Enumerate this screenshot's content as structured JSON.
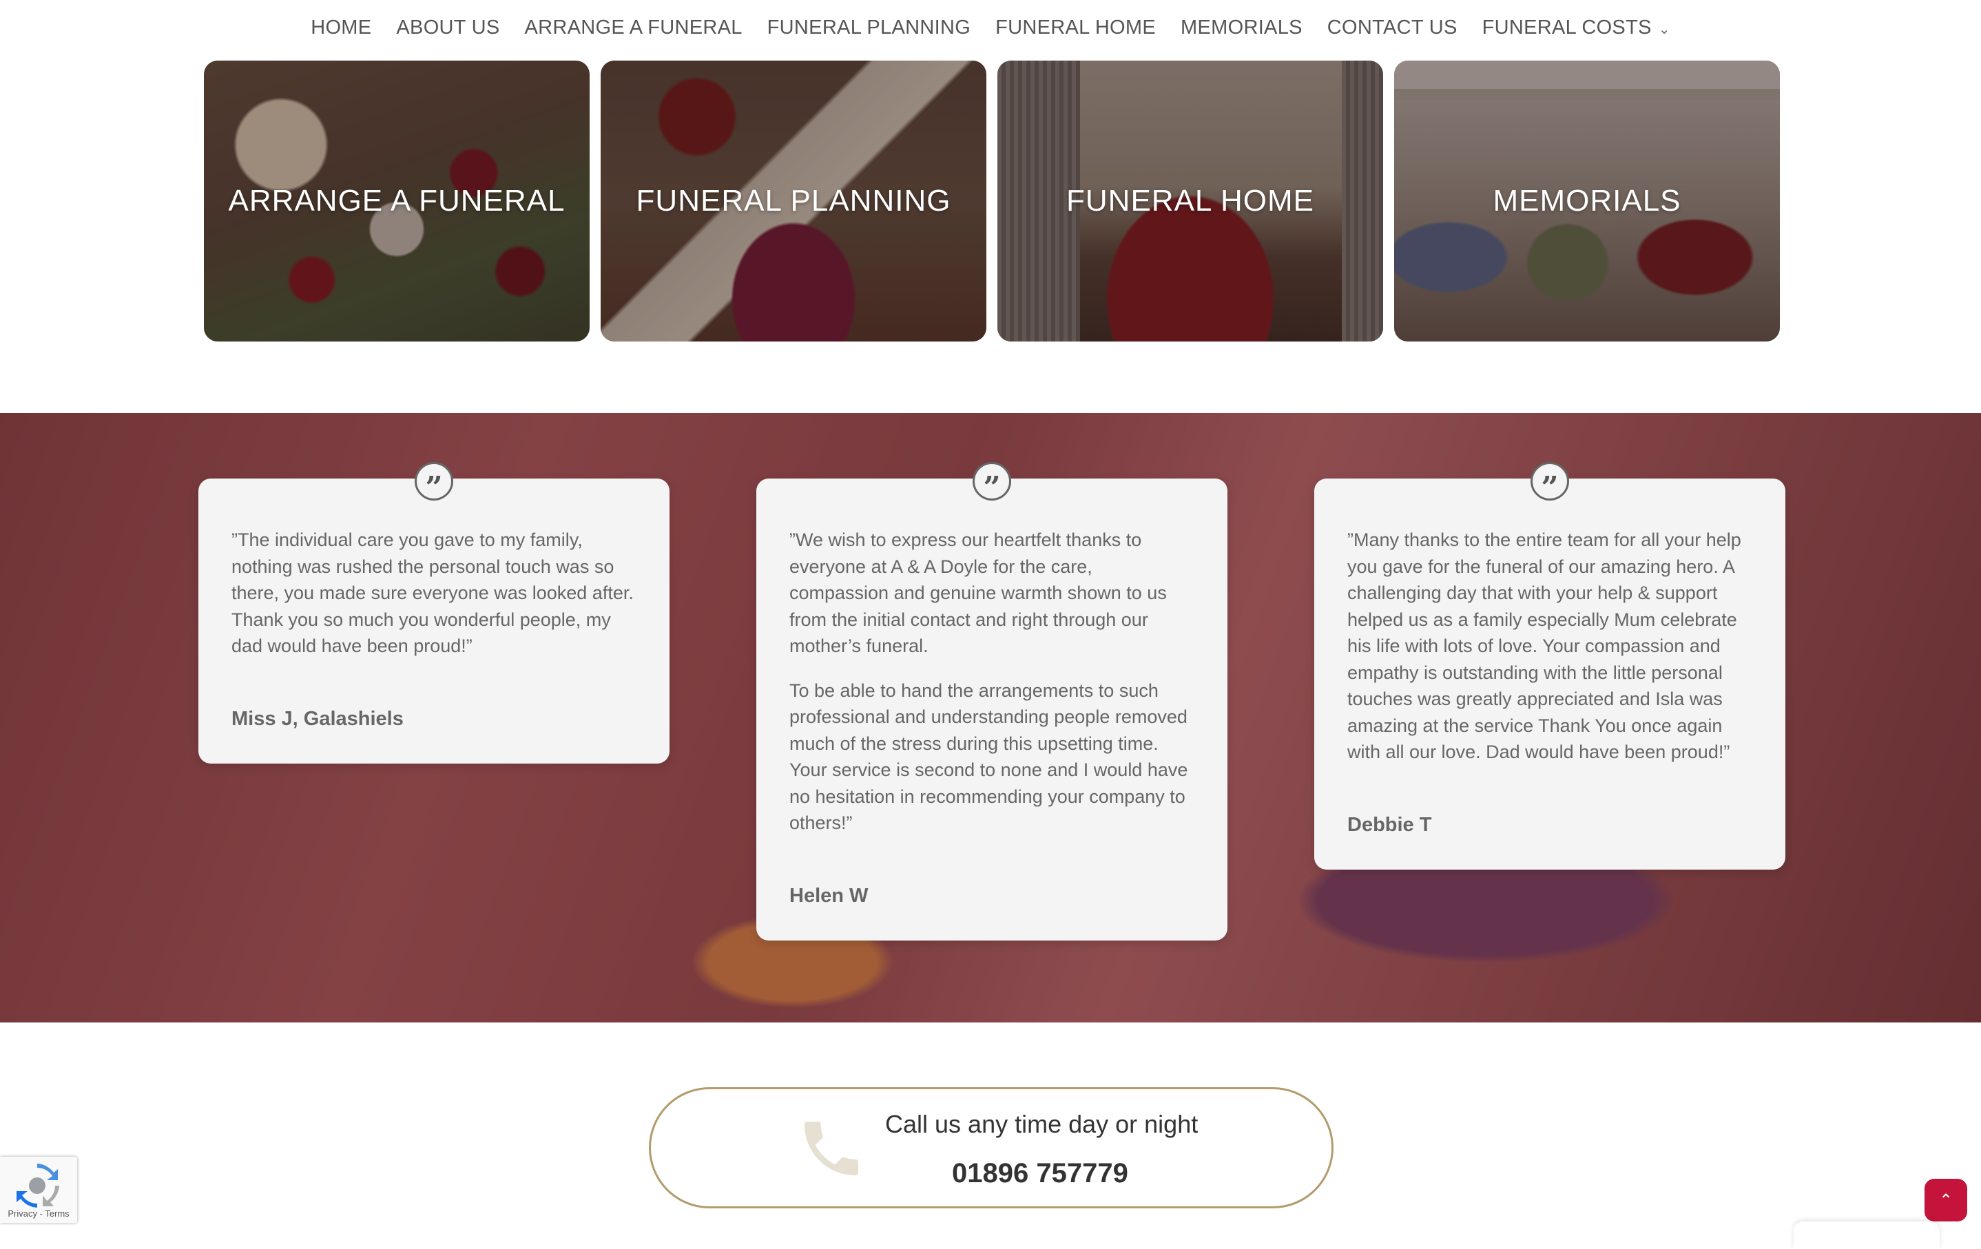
{
  "nav": {
    "items": [
      "HOME",
      "ABOUT US",
      "ARRANGE A FUNERAL",
      "FUNERAL PLANNING",
      "FUNERAL HOME",
      "MEMORIALS",
      "CONTACT US"
    ],
    "dropdown_label": "FUNERAL COSTS"
  },
  "tiles": [
    {
      "label": "ARRANGE A FUNERAL"
    },
    {
      "label": "FUNERAL PLANNING"
    },
    {
      "label": "FUNERAL HOME"
    },
    {
      "label": "MEMORIALS"
    }
  ],
  "testimonials": [
    {
      "paragraphs": [
        "”The individual care you gave to my family, nothing was rushed the personal touch was so there, you made sure everyone was looked after. Thank you so much you wonderful people, my dad would have been proud!”"
      ],
      "author": "Miss J, Galashiels"
    },
    {
      "paragraphs": [
        "”We wish to express our heartfelt thanks to everyone at A & A Doyle for the care, compassion and genuine warmth shown to us from the initial contact and right through our mother’s funeral.",
        "To be able to hand the arrangements to such professional and understanding people removed much of the stress during this upsetting time. Your service is second to none and I would have no hesitation in recommending your company to others!”"
      ],
      "author": "Helen W"
    },
    {
      "paragraphs": [
        "”Many thanks to the entire team for all your help you gave for the funeral of our amazing hero. A challenging day that with your help & support helped us as a family especially Mum celebrate his life with lots of love. Your compassion and empathy is outstanding with the little personal touches was greatly appreciated and Isla was amazing at the service Thank You once again with all our love. Dad would have been proud!”"
      ],
      "author": "Debbie T"
    }
  ],
  "call": {
    "title": "Call us any time day or night",
    "number": "01896 757779"
  },
  "recaptcha": {
    "terms": "Privacy - Terms"
  },
  "icons": {
    "quote": "quote-icon",
    "phone": "phone-icon",
    "back_to_top": "chevron-up-icon",
    "dropdown": "chevron-down-icon"
  },
  "colors": {
    "accent_red": "#c4143c",
    "callbox_border": "#b39b6e",
    "card_bg": "#f4f4f4",
    "phone_icon": "#e6e0d2"
  }
}
